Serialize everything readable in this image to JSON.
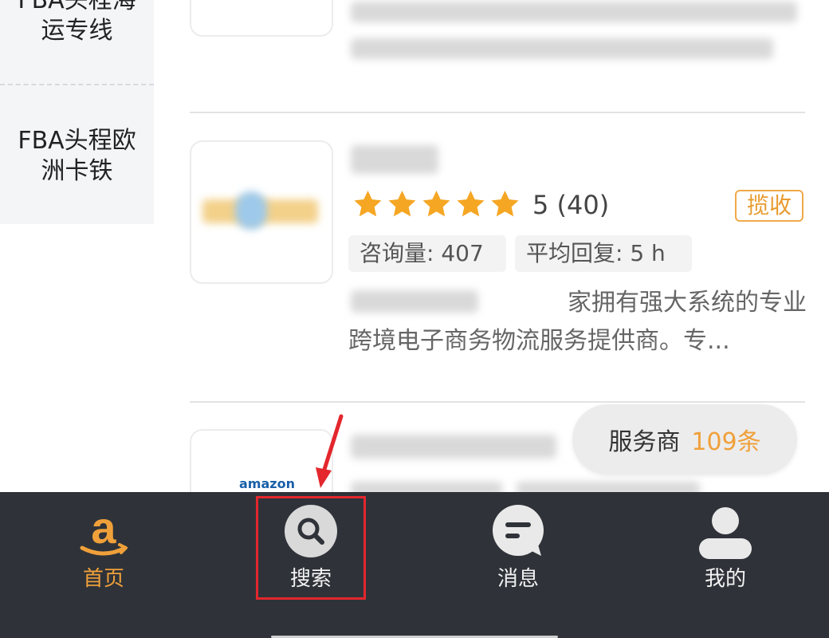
{
  "sidebar": {
    "categories": [
      {
        "label_line1": "FBA头程海",
        "label_line2": "运专线"
      },
      {
        "label_line1": "FBA头程欧",
        "label_line2": "洲卡铁"
      }
    ]
  },
  "listing": {
    "rating_value": "5",
    "review_count": "(40)",
    "pickup_badge": "揽收",
    "inquiries_label": "咨询量: 407",
    "avg_reply_label": "平均回复: 5 h",
    "description_line1": "家拥有强大系统的专业",
    "description_line2": "跨境电子商务物流服务提供商。专..."
  },
  "provider_count": {
    "label": "服务商",
    "value": "109条"
  },
  "thumbnail_logo_text": "amazon",
  "tabbar": {
    "tabs": [
      {
        "label": "首页",
        "icon": "amazon-home-icon",
        "active": true
      },
      {
        "label": "搜索",
        "icon": "search-icon",
        "active": false
      },
      {
        "label": "消息",
        "icon": "message-icon",
        "active": false
      },
      {
        "label": "我的",
        "icon": "profile-icon",
        "active": false
      }
    ]
  },
  "colors": {
    "accent": "#f0a03a",
    "tabbar_bg": "#2f3339",
    "highlight": "#e3272d"
  }
}
